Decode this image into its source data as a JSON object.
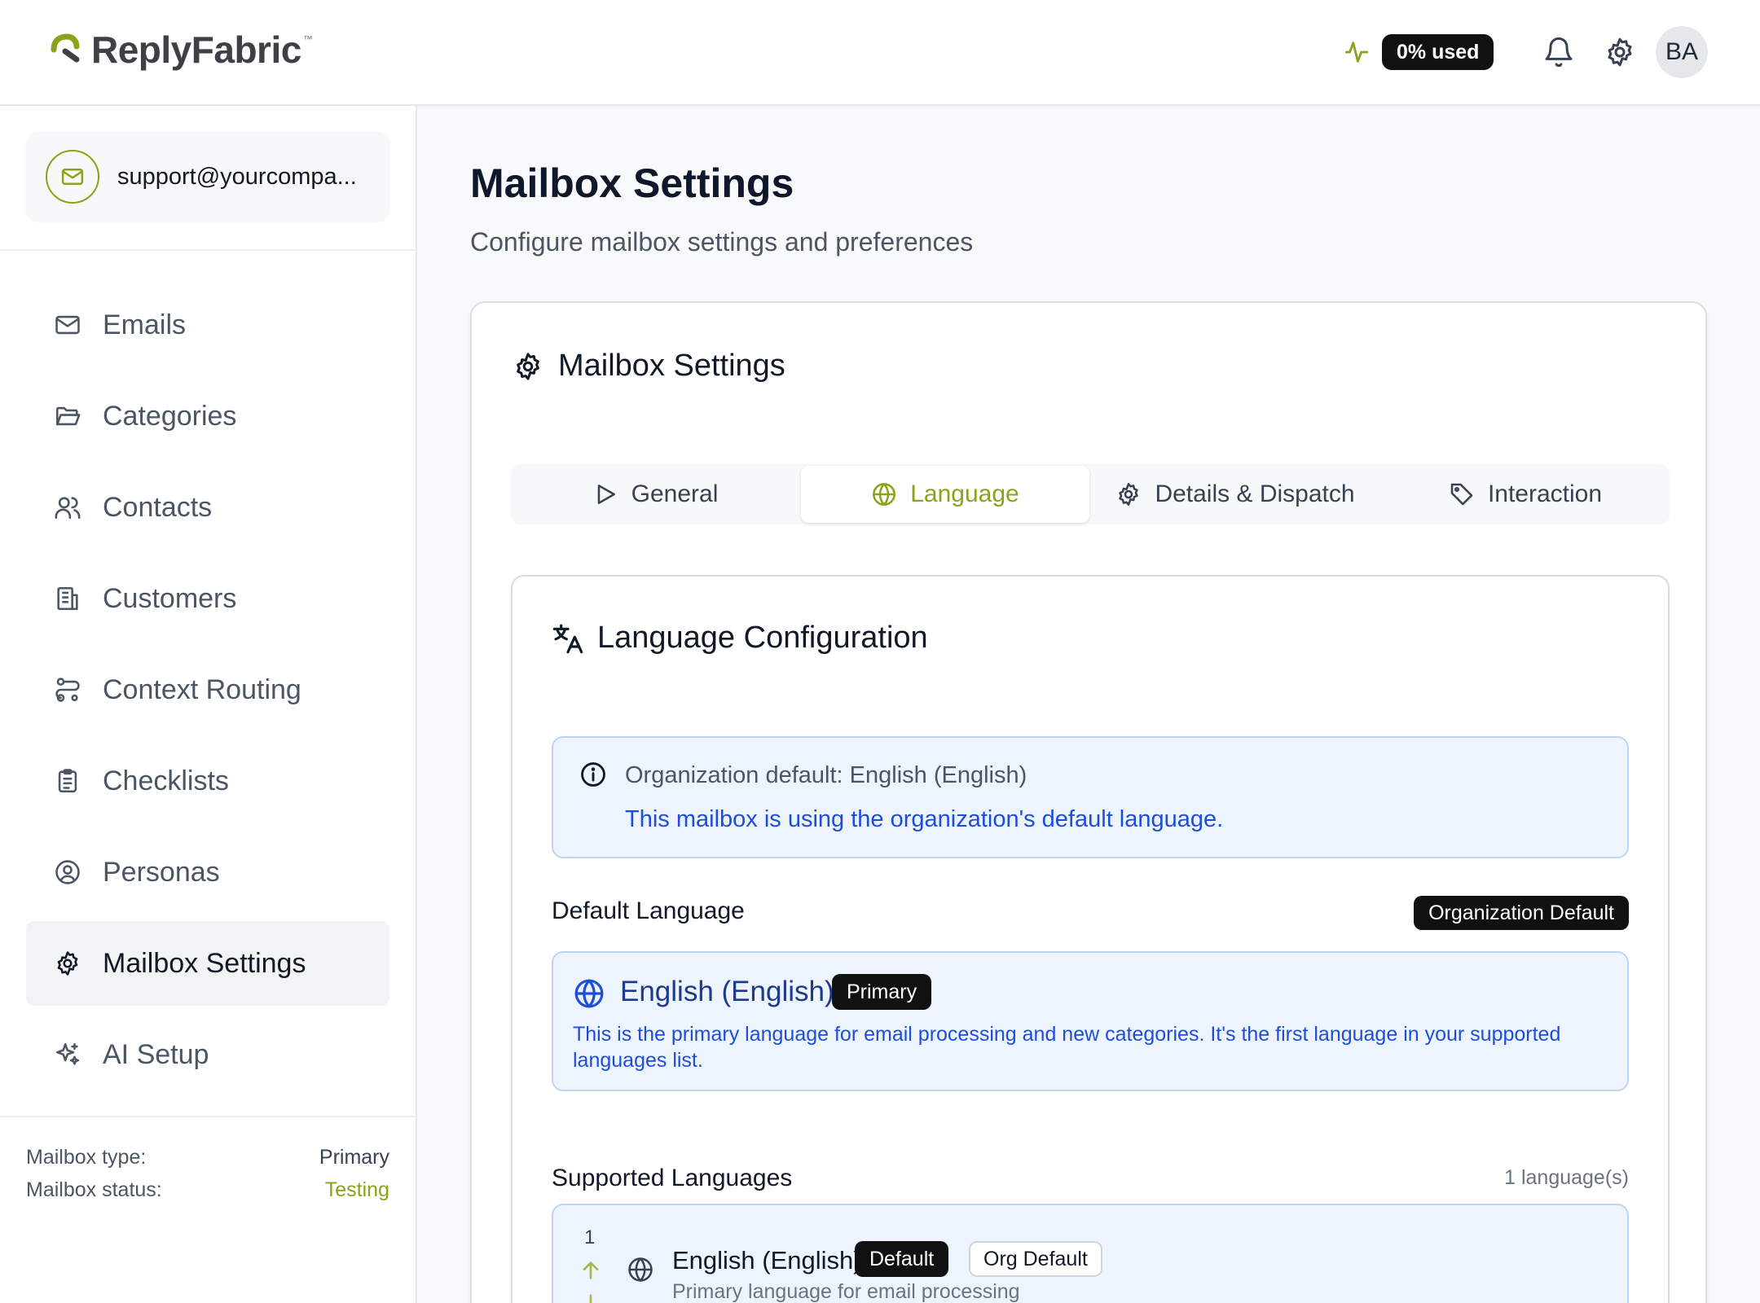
{
  "app": {
    "name": "ReplyFabric",
    "tm": "™",
    "brand_color": "#8aa31a"
  },
  "header": {
    "usage_label": "0% used",
    "avatar_initials": "BA"
  },
  "sidebar": {
    "mailbox_address": "support@yourcompa...",
    "items": [
      {
        "label": "Emails",
        "icon": "mail-icon"
      },
      {
        "label": "Categories",
        "icon": "folder-open-icon"
      },
      {
        "label": "Contacts",
        "icon": "users-icon"
      },
      {
        "label": "Customers",
        "icon": "building-icon"
      },
      {
        "label": "Context Routing",
        "icon": "route-icon"
      },
      {
        "label": "Checklists",
        "icon": "clipboard-list-icon"
      },
      {
        "label": "Personas",
        "icon": "user-circle-icon"
      },
      {
        "label": "Mailbox Settings",
        "icon": "gear-icon",
        "active": true
      },
      {
        "label": "AI Setup",
        "icon": "sparkles-icon"
      }
    ],
    "meta": {
      "type_label": "Mailbox type:",
      "type_value": "Primary",
      "status_label": "Mailbox status:",
      "status_value": "Testing"
    }
  },
  "main": {
    "title": "Mailbox Settings",
    "subtitle": "Configure mailbox settings and preferences",
    "card_title": "Mailbox Settings",
    "tabs": [
      {
        "label": "General",
        "icon": "play-icon"
      },
      {
        "label": "Language",
        "icon": "globe-icon",
        "active": true
      },
      {
        "label": "Details & Dispatch",
        "icon": "gear-icon"
      },
      {
        "label": "Interaction",
        "icon": "tag-icon"
      }
    ],
    "language": {
      "section_title": "Language Configuration",
      "info_line1": "Organization default: English (English)",
      "info_line2": "This mailbox is using the organization's default language.",
      "default_label": "Default Language",
      "default_badge": "Organization Default",
      "primary_name": "English (English)",
      "primary_badge": "Primary",
      "primary_desc": "This is the primary language for email processing and new categories. It's the first language in your supported languages list.",
      "supported_label": "Supported Languages",
      "supported_count": "1 language(s)",
      "rows": [
        {
          "index": "1",
          "name": "English (English)",
          "badge_default": "Default",
          "badge_org": "Org Default",
          "desc": "Primary language for email processing"
        }
      ]
    }
  }
}
